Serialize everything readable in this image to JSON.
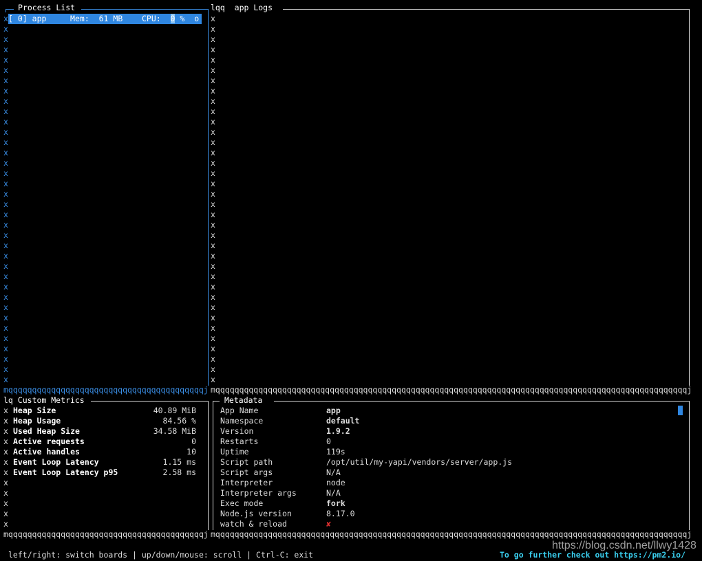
{
  "process_list": {
    "title": "Process List",
    "process": {
      "id": "[ 0]",
      "name": "app",
      "mem_label": "Mem:",
      "mem_value": "61",
      "mem_unit": "MB",
      "cpu_label": "CPU:",
      "cpu_value": "0",
      "cpu_unit": "%",
      "status": "o"
    }
  },
  "logs": {
    "title": "app Logs",
    "prefix": "lqq"
  },
  "custom_metrics": {
    "title": "Custom Metrics",
    "prefix": "lq",
    "items": [
      {
        "label": "Heap Size",
        "value": "40.89 MiB"
      },
      {
        "label": "Heap Usage",
        "value": "84.56 %"
      },
      {
        "label": "Used Heap Size",
        "value": "34.58 MiB"
      },
      {
        "label": "Active requests",
        "value": "0"
      },
      {
        "label": "Active handles",
        "value": "10"
      },
      {
        "label": "Event Loop Latency",
        "value": "1.15 ms"
      },
      {
        "label": "Event Loop Latency p95",
        "value": "2.58 ms"
      }
    ]
  },
  "metadata": {
    "title": "Metadata",
    "items": [
      {
        "label": "App Name",
        "value": "app",
        "bold": true
      },
      {
        "label": "Namespace",
        "value": "default",
        "bold": true
      },
      {
        "label": "Version",
        "value": "1.9.2",
        "bold": true
      },
      {
        "label": "Restarts",
        "value": "0"
      },
      {
        "label": "Uptime",
        "value": "119s"
      },
      {
        "label": "Script path",
        "value": "/opt/util/my-yapi/vendors/server/app.js"
      },
      {
        "label": "Script args",
        "value": "N/A"
      },
      {
        "label": "Interpreter",
        "value": "node"
      },
      {
        "label": "Interpreter args",
        "value": "N/A"
      },
      {
        "label": "Exec mode",
        "value": "fork",
        "bold": true
      },
      {
        "label": "Node.js version",
        "value": "8.17.0"
      },
      {
        "label": "watch & reload",
        "value": "✘",
        "color": "#e03030"
      }
    ]
  },
  "footer": {
    "help": "left/right: switch boards | up/down/mouse: scroll | Ctrl-C: exit",
    "link": "To go further check out https://pm2.io/"
  },
  "watermark": "https://blog.csdn.net/llwy1428",
  "colors": {
    "accent": "#2f86e0",
    "link": "#3ad0f0"
  }
}
